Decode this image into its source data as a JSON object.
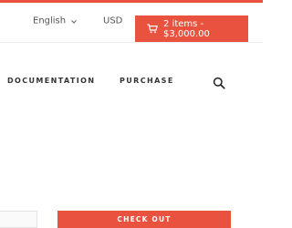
{
  "topbar": {
    "language": "English",
    "currency": "USD",
    "cart_label": "2 items - $3,000.00"
  },
  "nav": {
    "documentation": "DOCUMENTATION",
    "purchase": "PURCHASE"
  },
  "checkout": {
    "button_label": "CHECK OUT"
  },
  "colors": {
    "accent": "#e8523f",
    "text": "#444444"
  },
  "icons": {
    "cart": "cart-icon",
    "language_dropdown": "chevron-down-icon",
    "search": "search-icon"
  }
}
